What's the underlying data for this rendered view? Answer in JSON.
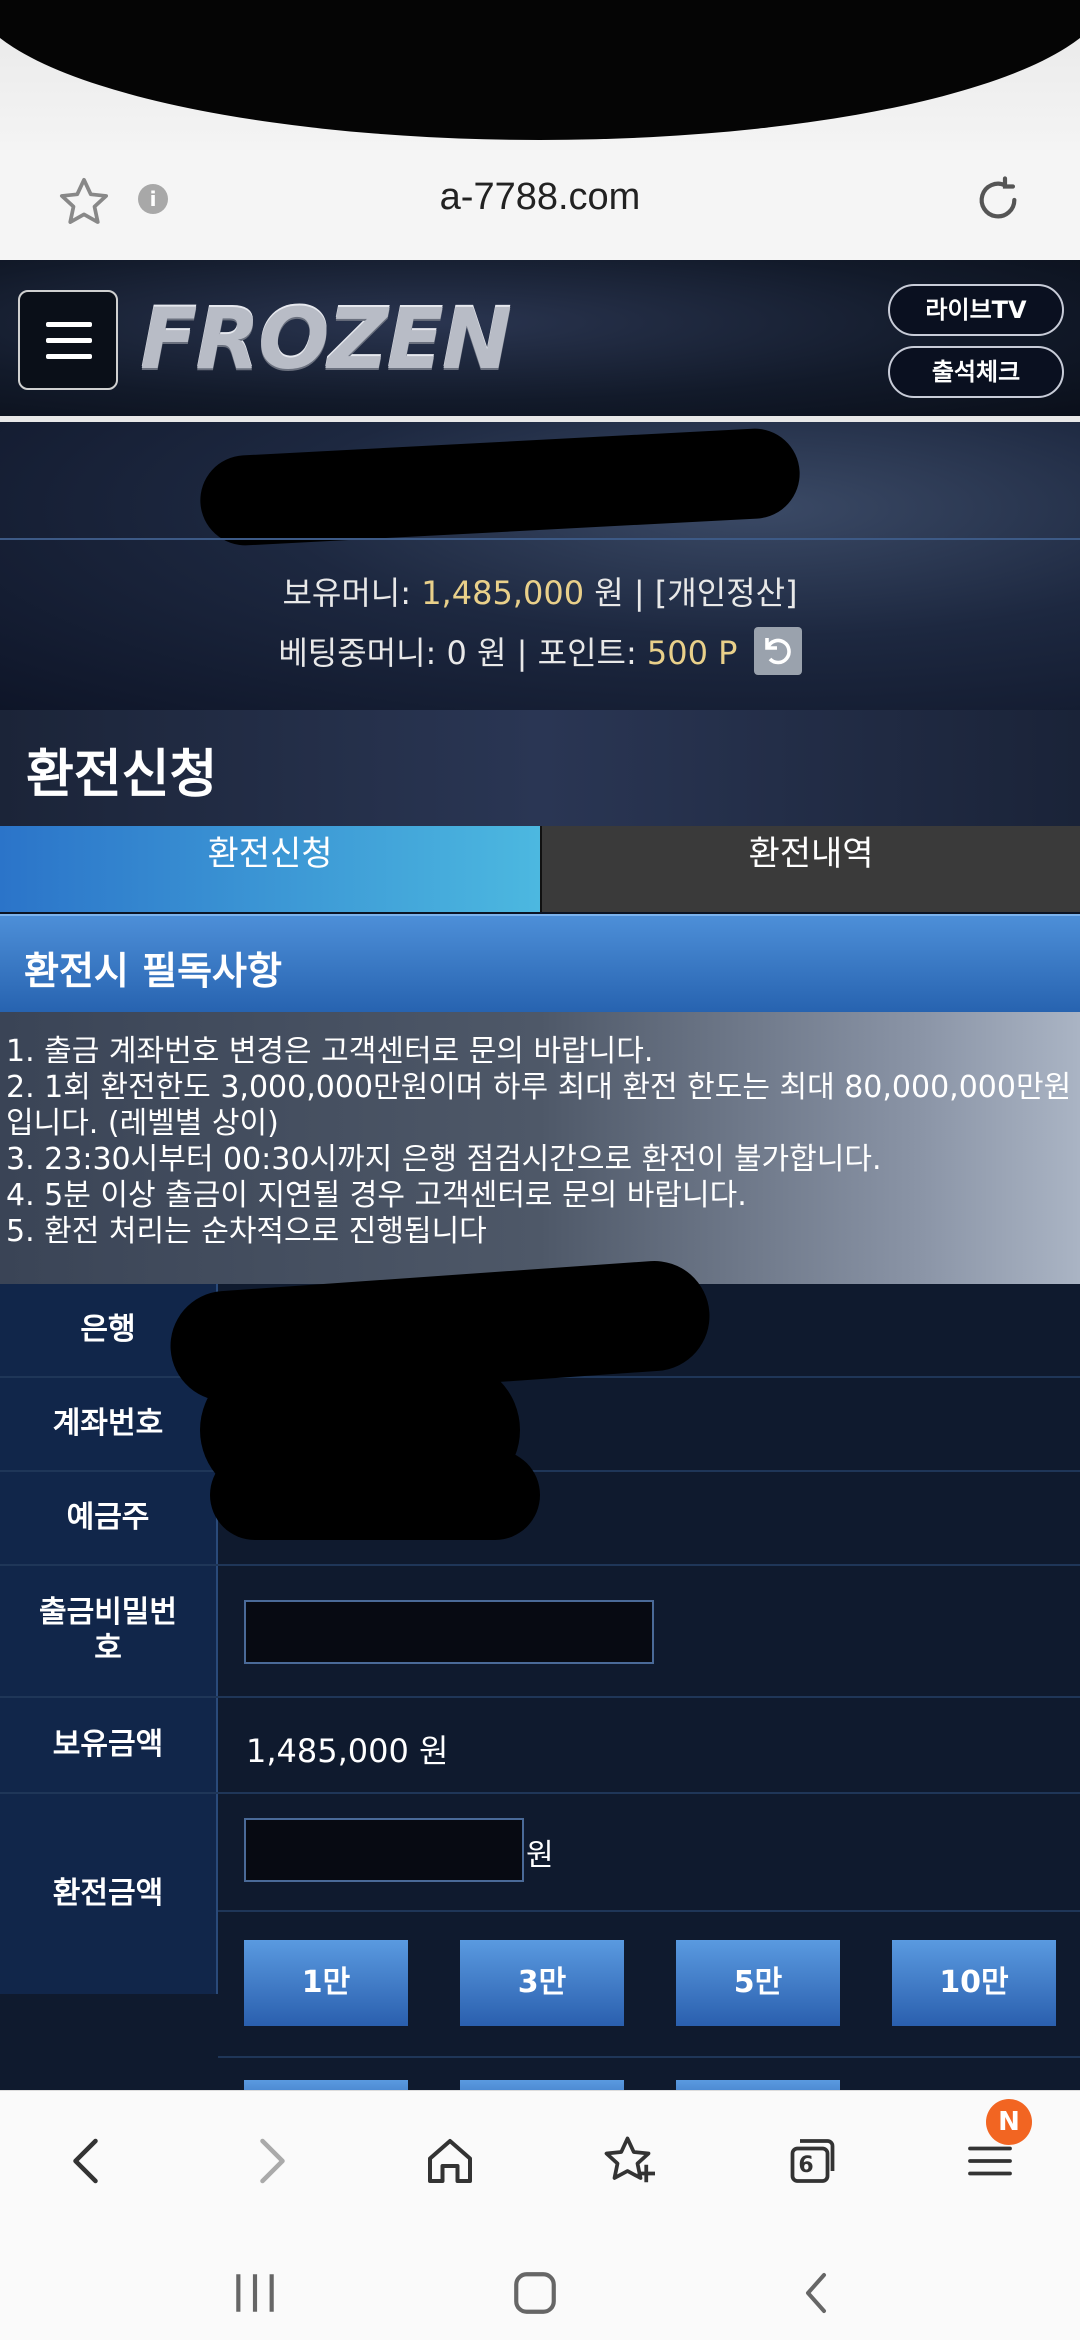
{
  "browser": {
    "url": "a-7788.com"
  },
  "header": {
    "logo": "FROZEN",
    "live_tv": "라이브TV",
    "attendance": "출석체크"
  },
  "account": {
    "holding_label": "보유머니:",
    "holding_value": "1,485,000",
    "holding_unit": "원",
    "settlement": "| [개인정산]",
    "betting_label": "베팅중머니:",
    "betting_value": "0 원",
    "points_label": "| 포인트:",
    "points_value": "500 P"
  },
  "page_title": "환전신청",
  "tabs": {
    "request": "환전신청",
    "history": "환전내역"
  },
  "notice": {
    "title": "환전시 필독사항",
    "lines": [
      "1. 출금 계좌번호 변경은 고객센터로 문의 바랍니다.",
      "2. 1회 환전한도 3,000,000만원이며 하루 최대 환전 한도는 최대 80,000,000만원",
      "입니다. (레벨별 상이)",
      "3. 23:30시부터 00:30시까지 은행 점검시간으로 환전이 불가합니다.",
      "4. 5분 이상 출금이 지연될 경우 고객센터로 문의 바랍니다.",
      "5. 환전 처리는 순차적으로 진행됩니다"
    ]
  },
  "form": {
    "bank_label": "은행",
    "account_label": "계좌번호",
    "holder_label": "예금주",
    "password_label_1": "출금비밀번",
    "password_label_2": "호",
    "balance_label": "보유금액",
    "balance_value": "1,485,000 원",
    "amount_label": "환전금액",
    "amount_unit": "원",
    "amount_buttons": [
      "1만",
      "3만",
      "5만",
      "10만"
    ]
  },
  "bottom_nav": {
    "tabs_count": "6",
    "menu_badge": "N"
  },
  "colors": {
    "accent_blue": "#2b74c9",
    "gold_text": "#e9d08a",
    "badge_orange": "#f26522"
  }
}
